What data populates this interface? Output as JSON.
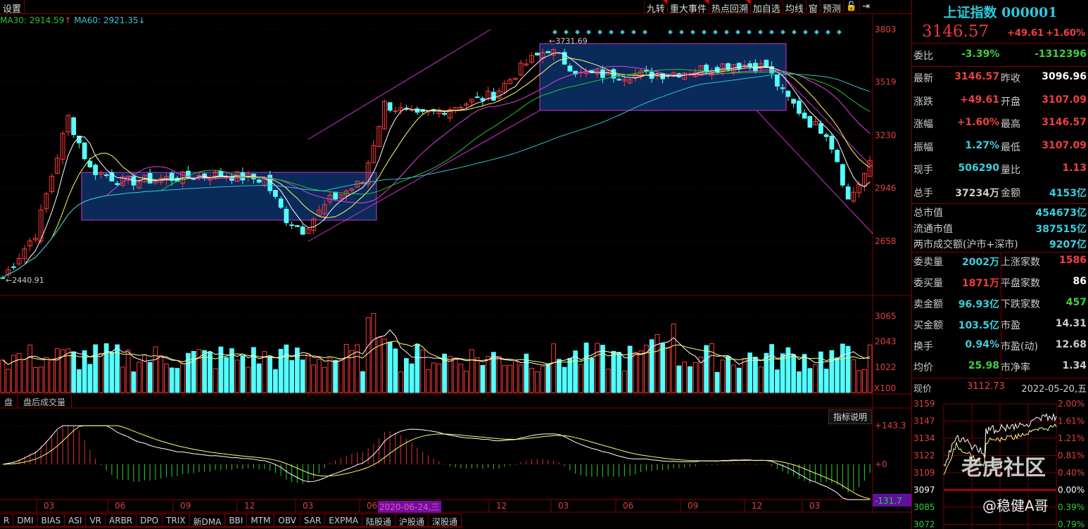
{
  "toolbar": {
    "settings": "设置",
    "buttons": [
      "九转",
      "重大事件",
      "热点回溯",
      "加自选",
      "均线",
      "窗",
      "预测"
    ],
    "lock_icon": "lock-icon",
    "collapse_icon": "arrow-right-bar-icon"
  },
  "legend": {
    "ma30": "MA30: 2914.59",
    "ma30_arrow": "↑",
    "ma60": "MA60: 2921.35",
    "ma60_arrow": "↓"
  },
  "price_axis": [
    "3803",
    "3519",
    "3230",
    "2946",
    "2658"
  ],
  "annotations": {
    "high": "3731.69",
    "low": "2440.91"
  },
  "volume_axis": [
    "3065",
    "2043",
    "1022"
  ],
  "volume_unit": "X100",
  "volume_tabs": [
    "盘",
    "盘后成交量"
  ],
  "macd": {
    "help": "指标说明",
    "axis": [
      "+143.3",
      "+0",
      "-131.7"
    ]
  },
  "x_axis": [
    "03",
    "06",
    "09",
    "12",
    "03",
    "06",
    "12",
    "03",
    "06",
    "09",
    "12",
    "03"
  ],
  "cursor_date": "2020-06-24,三",
  "indicator_tabs": [
    "R",
    "DMI",
    "BIAS",
    "ASI",
    "VR",
    "ARBR",
    "DPO",
    "TRIX",
    "新DMA",
    "BBI",
    "MTM",
    "OBV",
    "SAR",
    "EXPMA",
    "陆股通",
    "沪股通",
    "深股通"
  ],
  "quote": {
    "name": "上证指数 000001",
    "price": "3146.57",
    "change": "+49.61",
    "pct": "+1.60%",
    "weibi_label": "委比",
    "weibi_pct": "-3.39%",
    "weibi_val": "-1312396",
    "rows": [
      [
        "最新",
        "3146.57",
        "red",
        "昨收",
        "3096.96",
        "wht"
      ],
      [
        "涨跌",
        "+49.61",
        "red",
        "开盘",
        "3107.09",
        "red"
      ],
      [
        "涨幅",
        "+1.60%",
        "red",
        "最高",
        "3146.57",
        "red"
      ],
      [
        "振幅",
        "1.27%",
        "cyn",
        "最低",
        "3107.09",
        "red"
      ],
      [
        "现手",
        "506290",
        "cyn",
        "量比",
        "1.13",
        "red"
      ],
      [
        "总手",
        "37234万",
        "gry",
        "金额",
        "4153亿",
        "cyn"
      ]
    ],
    "market": [
      [
        "总市值",
        "454673亿"
      ],
      [
        "流通市值",
        "387515亿"
      ],
      [
        "两市成交额(沪市+深市)",
        "9207亿"
      ]
    ],
    "rows2": [
      [
        "委卖量",
        "2002万",
        "cyn",
        "上涨家数",
        "1586",
        "red"
      ],
      [
        "委买量",
        "1871万",
        "red",
        "平盘家数",
        "86",
        "wht"
      ],
      [
        "卖金额",
        "96.93亿",
        "cyn",
        "下跌家数",
        "457",
        "grn"
      ],
      [
        "买金额",
        "103.5亿",
        "cyn",
        "市盈",
        "14.31",
        "gry"
      ],
      [
        "换手",
        "0.94%",
        "cyn",
        "市盈(动)",
        "12.68",
        "gry"
      ],
      [
        "均价",
        "25.98",
        "grn",
        "市净率",
        "1.34",
        "gry"
      ]
    ],
    "now_label": "现价",
    "now_price": "3112.73",
    "date": "2022-05-20,五"
  },
  "mini_chart": {
    "left_axis": [
      "3159",
      "3147",
      "3134",
      "3122",
      "3109",
      "3097",
      "3085",
      "3072"
    ],
    "right_axis": [
      "2.00%",
      "1.61%",
      "1.21%",
      "0.81%",
      "0.40%",
      "0.00%",
      "0.39%",
      "0.79%"
    ]
  },
  "watermark": {
    "brand": "老虎社区",
    "author": "@稳健A哥"
  },
  "colors": {
    "up": "#ff3a3a",
    "down": "#54ffff",
    "grid": "#800000",
    "box": "#0a2a5a",
    "trend": "#d030d0"
  },
  "chart_data": {
    "type": "candlestick",
    "price_keypoints": [
      [
        0,
        2460
      ],
      [
        6,
        2700
      ],
      [
        12,
        3330
      ],
      [
        16,
        3050
      ],
      [
        22,
        2980
      ],
      [
        40,
        3020
      ],
      [
        48,
        2990
      ],
      [
        52,
        2780
      ],
      [
        55,
        2720
      ],
      [
        60,
        2880
      ],
      [
        66,
        2980
      ],
      [
        70,
        3400
      ],
      [
        76,
        3330
      ],
      [
        90,
        3450
      ],
      [
        96,
        3620
      ],
      [
        100,
        3700
      ],
      [
        106,
        3560
      ],
      [
        120,
        3560
      ],
      [
        126,
        3580
      ],
      [
        134,
        3620
      ],
      [
        140,
        3600
      ],
      [
        143,
        3460
      ],
      [
        148,
        3300
      ],
      [
        151,
        3250
      ],
      [
        153,
        3100
      ],
      [
        155,
        2880
      ],
      [
        159,
        3070
      ]
    ],
    "ylim": [
      2400,
      3850
    ],
    "volume_ylim": [
      0,
      3400
    ],
    "macd_ylim": [
      -131.7,
      143.3
    ]
  }
}
